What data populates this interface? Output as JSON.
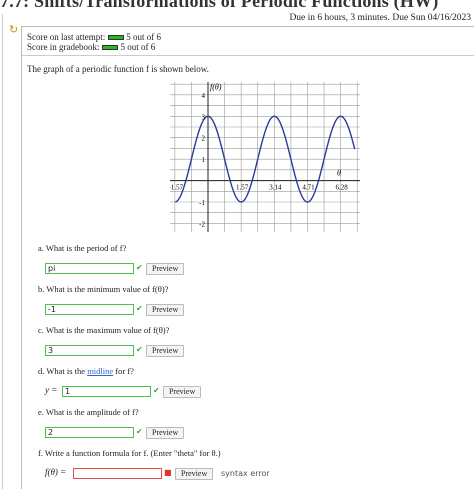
{
  "header": {
    "title": "7.7: Shifts/Transformations of Periodic Functions (HW)",
    "due": "Due in 6 hours, 3 minutes. Due Sun 04/16/2023"
  },
  "score": {
    "last_attempt_label": "Score on last attempt:",
    "last_attempt_value": "5 out of 6",
    "gradebook_label": "Score in gradebook:",
    "gradebook_value": "5 out of 6"
  },
  "problem": {
    "intro": "The graph of a periodic function f is shown below."
  },
  "graph": {
    "ylabel": "f(θ)",
    "xlabel": "θ",
    "xticks": [
      "-1.57",
      "1.57",
      "3.14",
      "4.71",
      "6.28"
    ],
    "yticks": [
      "4",
      "3",
      "2",
      "1",
      "-1",
      "-2"
    ]
  },
  "chart_data": {
    "type": "line",
    "function": "f(θ) = 2cos(2θ) + 1",
    "xlim": [
      -1.8,
      7.2
    ],
    "ylim": [
      -2.4,
      4.6
    ],
    "grid": true,
    "xlabel": "θ",
    "ylabel": "f(θ)"
  },
  "questions": {
    "a": {
      "text": "a. What is the period of f?",
      "value": "pi",
      "button": "Preview"
    },
    "b": {
      "text": "b. What is the minimum value of f(θ)?",
      "value": "-1",
      "button": "Preview"
    },
    "c": {
      "text": "c. What is the maximum value of f(θ)?",
      "value": "3",
      "button": "Preview"
    },
    "d": {
      "text_pre": "d. What is the ",
      "link": "midline",
      "text_post": " for f?",
      "label": "y =",
      "value": "1",
      "button": "Preview"
    },
    "e": {
      "text": "e. What is the amplitude of f?",
      "value": "2",
      "button": "Preview"
    },
    "f": {
      "text": "f. Write a function formula for f. (Enter \"theta\" for θ.)",
      "label": "f(θ) =",
      "value": "",
      "button": "Preview",
      "status": "syntax error"
    }
  },
  "colors": {
    "curve": "#2a3b9b",
    "correct": "#4fc04f",
    "error": "#e05050",
    "score_bar": "#2bb52b"
  }
}
